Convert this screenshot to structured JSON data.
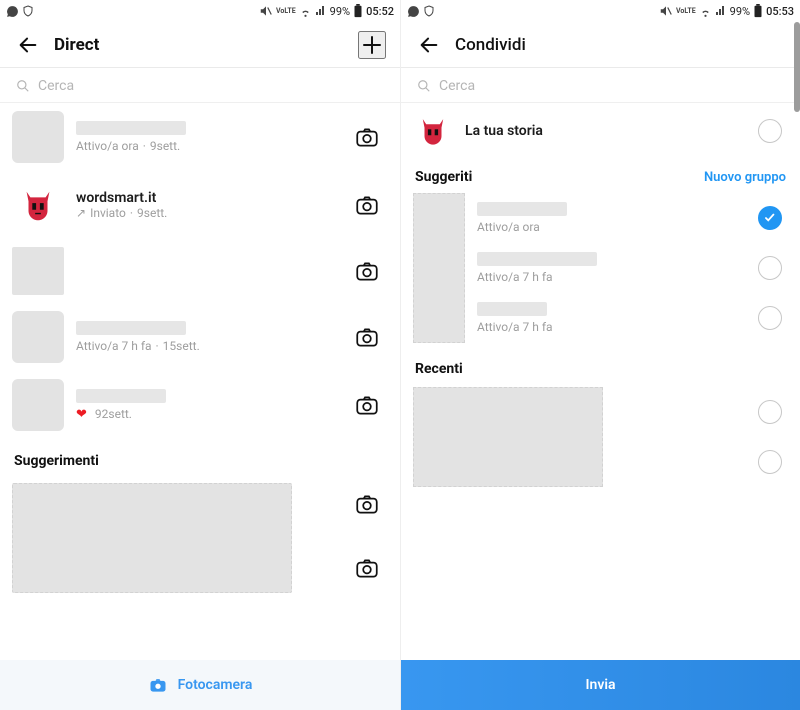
{
  "left": {
    "status": {
      "battery": "99%",
      "time": "05:52"
    },
    "header": {
      "title": "Direct"
    },
    "search": {
      "placeholder": "Cerca"
    },
    "rows": [
      {
        "status": "Attivo/a ora",
        "age": "9sett."
      },
      {
        "name": "wordsmart.it",
        "status": "Inviato",
        "age": "9sett.",
        "sentArrow": "↗"
      },
      {
        "status": "",
        "age": ""
      },
      {
        "status": "Attivo/a 7 h fa",
        "age": "15sett."
      },
      {
        "hearted": true,
        "age": "92sett."
      }
    ],
    "suggest_title": "Suggerimenti",
    "bottom": {
      "label": "Fotocamera"
    }
  },
  "right": {
    "status": {
      "battery": "99%",
      "time": "05:53"
    },
    "header": {
      "title": "Condividi"
    },
    "search": {
      "placeholder": "Cerca"
    },
    "story": {
      "label": "La tua storia"
    },
    "suggest_title": "Suggeriti",
    "new_group": "Nuovo gruppo",
    "rows": [
      {
        "status": "Attivo/a ora",
        "checked": true
      },
      {
        "status": "Attivo/a 7 h fa",
        "checked": false
      },
      {
        "status": "Attivo/a 7 h fa",
        "checked": false
      }
    ],
    "recent_title": "Recenti",
    "bottom": {
      "label": "Invia"
    }
  }
}
